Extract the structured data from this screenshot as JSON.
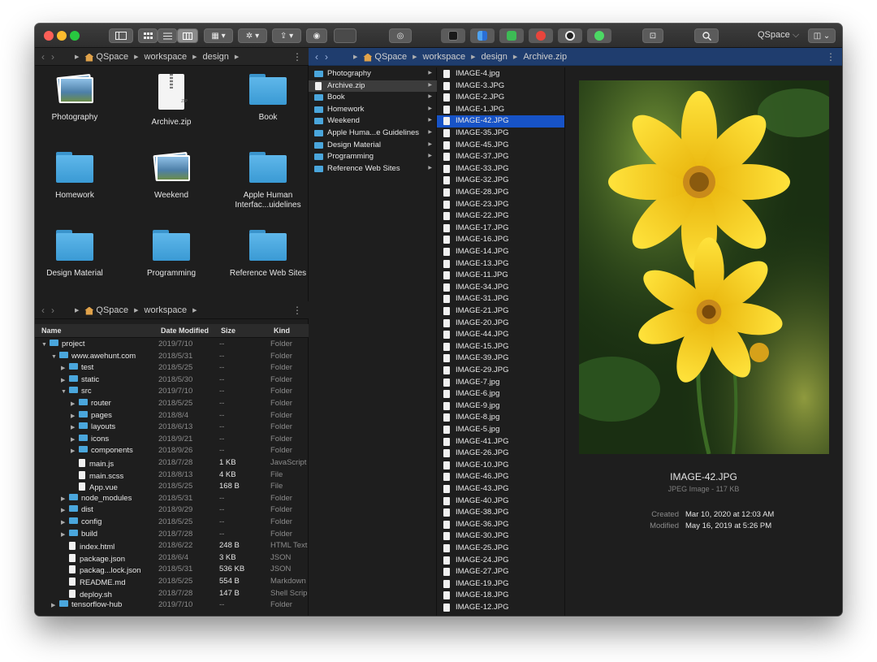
{
  "titlebar": {
    "app_name": "QSpace",
    "traffic_colors": [
      "#fc5f57",
      "#fdbc2e",
      "#28c840"
    ]
  },
  "left_top": {
    "path": [
      "QSpace",
      "workspace",
      "design"
    ],
    "items": [
      {
        "label": "Photography",
        "icon": "photo-stack-icon"
      },
      {
        "label": "Archive.zip",
        "icon": "zip-file-icon"
      },
      {
        "label": "Book",
        "icon": "folder-icon"
      },
      {
        "label": "Homework",
        "icon": "folder-icon"
      },
      {
        "label": "Weekend",
        "icon": "photo-stack-icon"
      },
      {
        "label": "Apple Human Interfac...uidelines",
        "icon": "folder-icon"
      },
      {
        "label": "Design Material",
        "icon": "folder-icon"
      },
      {
        "label": "Programming",
        "icon": "folder-icon"
      },
      {
        "label": "Reference Web Sites",
        "icon": "folder-icon"
      }
    ]
  },
  "left_bottom": {
    "path": [
      "QSpace",
      "workspace"
    ],
    "columns": [
      "Name",
      "Date Modified",
      "Size",
      "Kind"
    ],
    "rows": [
      {
        "name": "project",
        "date": "2019/7/10",
        "size": "--",
        "kind": "Folder",
        "type": "folder",
        "level": 0,
        "toggle": "open"
      },
      {
        "name": "www.awehunt.com",
        "date": "2018/5/31",
        "size": "--",
        "kind": "Folder",
        "type": "folder",
        "level": 1,
        "toggle": "open"
      },
      {
        "name": "test",
        "date": "2018/5/25",
        "size": "--",
        "kind": "Folder",
        "type": "folder",
        "level": 2,
        "toggle": "closed"
      },
      {
        "name": "static",
        "date": "2018/5/30",
        "size": "--",
        "kind": "Folder",
        "type": "folder",
        "level": 2,
        "toggle": "closed"
      },
      {
        "name": "src",
        "date": "2019/7/10",
        "size": "--",
        "kind": "Folder",
        "type": "folder",
        "level": 2,
        "toggle": "open"
      },
      {
        "name": "router",
        "date": "2018/5/25",
        "size": "--",
        "kind": "Folder",
        "type": "folder",
        "level": 3,
        "toggle": "closed"
      },
      {
        "name": "pages",
        "date": "2018/8/4",
        "size": "--",
        "kind": "Folder",
        "type": "folder",
        "level": 3,
        "toggle": "closed"
      },
      {
        "name": "layouts",
        "date": "2018/6/13",
        "size": "--",
        "kind": "Folder",
        "type": "folder",
        "level": 3,
        "toggle": "closed"
      },
      {
        "name": "icons",
        "date": "2018/9/21",
        "size": "--",
        "kind": "Folder",
        "type": "folder",
        "level": 3,
        "toggle": "closed"
      },
      {
        "name": "components",
        "date": "2018/9/26",
        "size": "--",
        "kind": "Folder",
        "type": "folder",
        "level": 3,
        "toggle": "closed"
      },
      {
        "name": "main.js",
        "date": "2018/7/28",
        "size": "1 KB",
        "kind": "JavaScript",
        "type": "file",
        "level": 3,
        "toggle": "none"
      },
      {
        "name": "main.scss",
        "date": "2018/8/13",
        "size": "4 KB",
        "kind": "File",
        "type": "file",
        "level": 3,
        "toggle": "none"
      },
      {
        "name": "App.vue",
        "date": "2018/5/25",
        "size": "168 B",
        "kind": "File",
        "type": "file",
        "level": 3,
        "toggle": "none"
      },
      {
        "name": "node_modules",
        "date": "2018/5/31",
        "size": "--",
        "kind": "Folder",
        "type": "folder",
        "level": 2,
        "toggle": "closed"
      },
      {
        "name": "dist",
        "date": "2018/9/29",
        "size": "--",
        "kind": "Folder",
        "type": "folder",
        "level": 2,
        "toggle": "closed"
      },
      {
        "name": "config",
        "date": "2018/5/25",
        "size": "--",
        "kind": "Folder",
        "type": "folder",
        "level": 2,
        "toggle": "closed"
      },
      {
        "name": "build",
        "date": "2018/7/28",
        "size": "--",
        "kind": "Folder",
        "type": "folder",
        "level": 2,
        "toggle": "closed"
      },
      {
        "name": "index.html",
        "date": "2018/6/22",
        "size": "248 B",
        "kind": "HTML Text",
        "type": "file",
        "level": 2,
        "toggle": "none"
      },
      {
        "name": "package.json",
        "date": "2018/6/4",
        "size": "3 KB",
        "kind": "JSON",
        "type": "file",
        "level": 2,
        "toggle": "none"
      },
      {
        "name": "packag...lock.json",
        "date": "2018/5/31",
        "size": "536 KB",
        "kind": "JSON",
        "type": "file",
        "level": 2,
        "toggle": "none"
      },
      {
        "name": "README.md",
        "date": "2018/5/25",
        "size": "554 B",
        "kind": "Markdown",
        "type": "file",
        "level": 2,
        "toggle": "none"
      },
      {
        "name": "deploy.sh",
        "date": "2018/7/28",
        "size": "147 B",
        "kind": "Shell Scrip",
        "type": "file",
        "level": 2,
        "toggle": "none"
      },
      {
        "name": "tensorflow-hub",
        "date": "2019/7/10",
        "size": "--",
        "kind": "Folder",
        "type": "folder",
        "level": 1,
        "toggle": "closed"
      }
    ]
  },
  "right": {
    "path": [
      "QSpace",
      "workspace",
      "design",
      "Archive.zip"
    ],
    "column1": [
      {
        "label": "Photography",
        "type": "folder"
      },
      {
        "label": "Archive.zip",
        "type": "file",
        "selected": true
      },
      {
        "label": "Book",
        "type": "folder"
      },
      {
        "label": "Homework",
        "type": "folder"
      },
      {
        "label": "Weekend",
        "type": "folder"
      },
      {
        "label": "Apple Huma...e Guidelines",
        "type": "folder"
      },
      {
        "label": "Design Material",
        "type": "folder"
      },
      {
        "label": "Programming",
        "type": "folder"
      },
      {
        "label": "Reference Web Sites",
        "type": "folder"
      }
    ],
    "column2": [
      "IMAGE-4.jpg",
      "IMAGE-3.JPG",
      "IMAGE-2.JPG",
      "IMAGE-1.JPG",
      "IMAGE-42.JPG",
      "IMAGE-35.JPG",
      "IMAGE-45.JPG",
      "IMAGE-37.JPG",
      "IMAGE-33.JPG",
      "IMAGE-32.JPG",
      "IMAGE-28.JPG",
      "IMAGE-23.JPG",
      "IMAGE-22.JPG",
      "IMAGE-17.JPG",
      "IMAGE-16.JPG",
      "IMAGE-14.JPG",
      "IMAGE-13.JPG",
      "IMAGE-11.JPG",
      "IMAGE-34.JPG",
      "IMAGE-31.JPG",
      "IMAGE-21.JPG",
      "IMAGE-20.JPG",
      "IMAGE-44.JPG",
      "IMAGE-15.JPG",
      "IMAGE-39.JPG",
      "IMAGE-29.JPG",
      "IMAGE-7.jpg",
      "IMAGE-6.jpg",
      "IMAGE-9.jpg",
      "IMAGE-8.jpg",
      "IMAGE-5.jpg",
      "IMAGE-41.JPG",
      "IMAGE-26.JPG",
      "IMAGE-10.JPG",
      "IMAGE-46.JPG",
      "IMAGE-43.JPG",
      "IMAGE-40.JPG",
      "IMAGE-38.JPG",
      "IMAGE-36.JPG",
      "IMAGE-30.JPG",
      "IMAGE-25.JPG",
      "IMAGE-24.JPG",
      "IMAGE-27.JPG",
      "IMAGE-19.JPG",
      "IMAGE-18.JPG",
      "IMAGE-12.JPG"
    ],
    "selected_index": 4,
    "preview": {
      "name": "IMAGE-42.JPG",
      "kind": "JPEG Image - 117 KB",
      "created_label": "Created",
      "created": "Mar 10, 2020 at 12:03 AM",
      "modified_label": "Modified",
      "modified": "May 16, 2019 at 5:26 PM"
    }
  }
}
